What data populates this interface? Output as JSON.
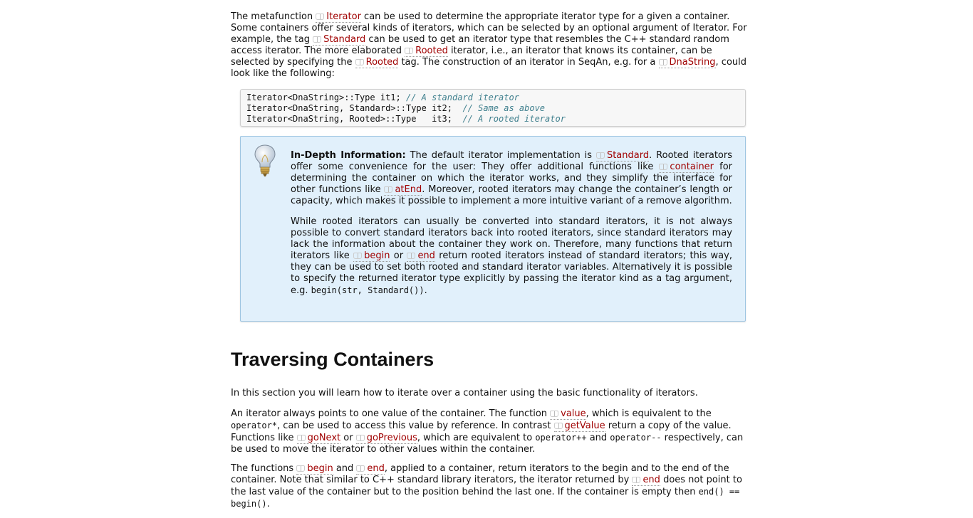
{
  "intro": {
    "t1": "The metafunction ",
    "l1": "Iterator",
    "t2": " can be used to determine the appropriate iterator type for a given a container. Some containers offer several kinds of iterators, which can be selected by an optional argument of Iterator. For example, the tag ",
    "l2": "Standard",
    "t3": " can be used to get an iterator type that resembles the C++ standard random access iterator. The more elaborated ",
    "l3": "Rooted",
    "t4": " iterator, i.e., an iterator that knows its container, can be selected by specifying the ",
    "l4": "Rooted",
    "t5": " tag. The construction of an iterator in SeqAn, e.g. for a ",
    "l5": "DnaString",
    "t6": ", could look like the following:"
  },
  "code": {
    "lines": [
      {
        "code": "Iterator<DnaString>::Type it1; ",
        "comment": "// A standard iterator"
      },
      {
        "code": "Iterator<DnaString, Standard>::Type it2;  ",
        "comment": "// Same as above"
      },
      {
        "code": "Iterator<DnaString, Rooted>::Type   it3;  ",
        "comment": "// A rooted iterator"
      }
    ]
  },
  "info": {
    "heading": "In-Depth Information:",
    "p1_t1": " The default iterator implementation is ",
    "p1_l1": "Standard",
    "p1_t2": ". Rooted iterators offer some convenience for the user: They offer additional functions like ",
    "p1_l2": "container",
    "p1_t3": " for determining the container on which the iterator works, and they simplify the interface for other functions like ",
    "p1_l3": "atEnd",
    "p1_t4": ". Moreover, rooted iterators may change the container’s length or capacity, which makes it possible to implement a more intuitive variant of a remove algorithm.",
    "p2_t1": "While rooted iterators can usually be converted into standard iterators, it is not always possible to convert standard iterators back into rooted iterators, since standard iterators may lack the information about the container they work on. Therefore, many functions that return iterators like ",
    "p2_l1": "begin",
    "p2_t2": " or ",
    "p2_l2": "end",
    "p2_t3": " return rooted iterators instead of standard iterators; this way, they can be used to set both rooted and standard iterator variables. Alternatively it is possible to specify the returned iterator type explicitly by passing the iterator kind as a tag argument, e.g. ",
    "p2_code": "begin(str, Standard())",
    "p2_t4": "."
  },
  "section": {
    "title": "Traversing Containers",
    "p1": "In this section you will learn how to iterate over a container using the basic functionality of iterators.",
    "p2_t1": "An iterator always points to one value of the container. The function ",
    "p2_l1": "value",
    "p2_t2": ", which is equivalent to the ",
    "p2_c1": "operator*",
    "p2_t3": ", can be used to access this value by reference. In contrast ",
    "p2_l2": "getValue",
    "p2_t4": " return a copy of the value. Functions like ",
    "p2_l3": "goNext",
    "p2_t5": " or ",
    "p2_l4": "goPrevious",
    "p2_t6": ", which are equivalent to ",
    "p2_c2": "operator++",
    "p2_t7": " and ",
    "p2_c3": "operator--",
    "p2_t8": " respectively, can be used to move the iterator to other values within the container.",
    "p3_t1": "The functions ",
    "p3_l1": "begin",
    "p3_t2": " and ",
    "p3_l2": "end",
    "p3_t3": ", applied to a container, return iterators to the begin and to the end of the container. Note that similar to C++ standard library iterators, the iterator returned by ",
    "p3_l3": "end",
    "p3_t4": " does not point to the last value of the container but to the position behind the last one. If the container is empty then ",
    "p3_c1": "end() == begin()",
    "p3_t5": "."
  }
}
